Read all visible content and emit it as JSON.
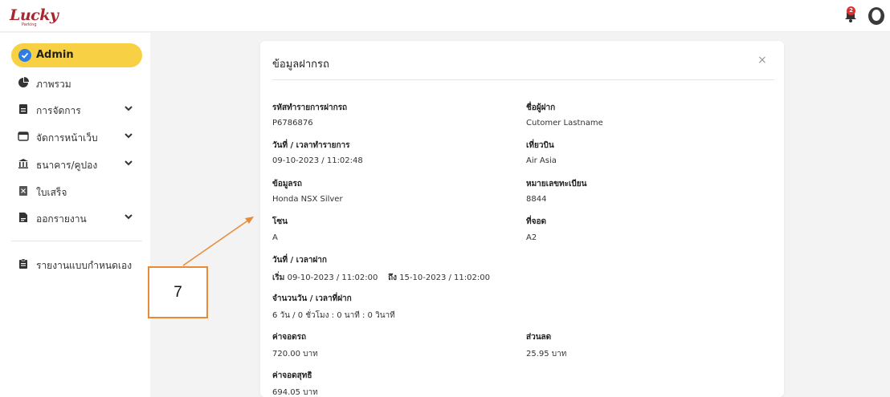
{
  "header": {
    "logo_text": "Lucky",
    "logo_sub": "Parking",
    "notification_count": "2"
  },
  "sidebar": {
    "items": [
      {
        "label": "Admin",
        "active": true
      },
      {
        "label": "ภาพรวม"
      },
      {
        "label": "การจัดการ",
        "has_chevron": true
      },
      {
        "label": "จัดการหน้าเว็บ",
        "has_chevron": true
      },
      {
        "label": "ธนาคาร/คูปอง",
        "has_chevron": true
      },
      {
        "label": "ใบเสร็จ"
      },
      {
        "label": "ออกรายงาน",
        "has_chevron": true
      },
      {
        "label": "รายงานแบบกำหนดเอง"
      }
    ]
  },
  "modal": {
    "title": "ข้อมูลฝากรถ",
    "close": "×",
    "fields": {
      "transaction_code_label": "รหัสทำรายการฝากรถ",
      "transaction_code": "P6786876",
      "depositor_label": "ชื่อผู้ฝาก",
      "depositor": "Cutomer Lastname",
      "datetime_label": "วันที่ / เวลาทำรายการ",
      "datetime": "09-10-2023 / 11:02:48",
      "flight_label": "เที่ยวบิน",
      "flight": "Air Asia",
      "car_info_label": "ข้อมูลรถ",
      "car_info": "Honda NSX Silver",
      "plate_label": "หมายเลขทะเบียน",
      "plate": "8844",
      "zone_label": "โซน",
      "zone": "A",
      "slot_label": "ที่จอด",
      "slot": "A2",
      "deposit_period_label": "วันที่ / เวลาฝาก",
      "start_label": "เริ่ม",
      "start_value": "09-10-2023 / 11:02:00",
      "end_label": "ถึง",
      "end_value": "15-10-2023 / 11:02:00",
      "duration_label": "จำนวนวัน / เวลาที่ฝาก",
      "duration": "6 วัน / 0 ชั่วโมง : 0 นาที : 0 วินาที",
      "parking_fee_label": "ค่าจอดรถ",
      "parking_fee": "720.00 บาท",
      "discount_label": "ส่วนลด",
      "discount": "25.95 บาท",
      "net_fee_label": "ค่าจอดสุทธิ",
      "net_fee": "694.05 บาท"
    }
  },
  "annotation": {
    "number": "7",
    "color": "#e98a37"
  },
  "colors": {
    "accent": "#f7d043",
    "brand": "#a6272e",
    "check_blue": "#2f7de1",
    "badge_red": "#e52b2b"
  }
}
